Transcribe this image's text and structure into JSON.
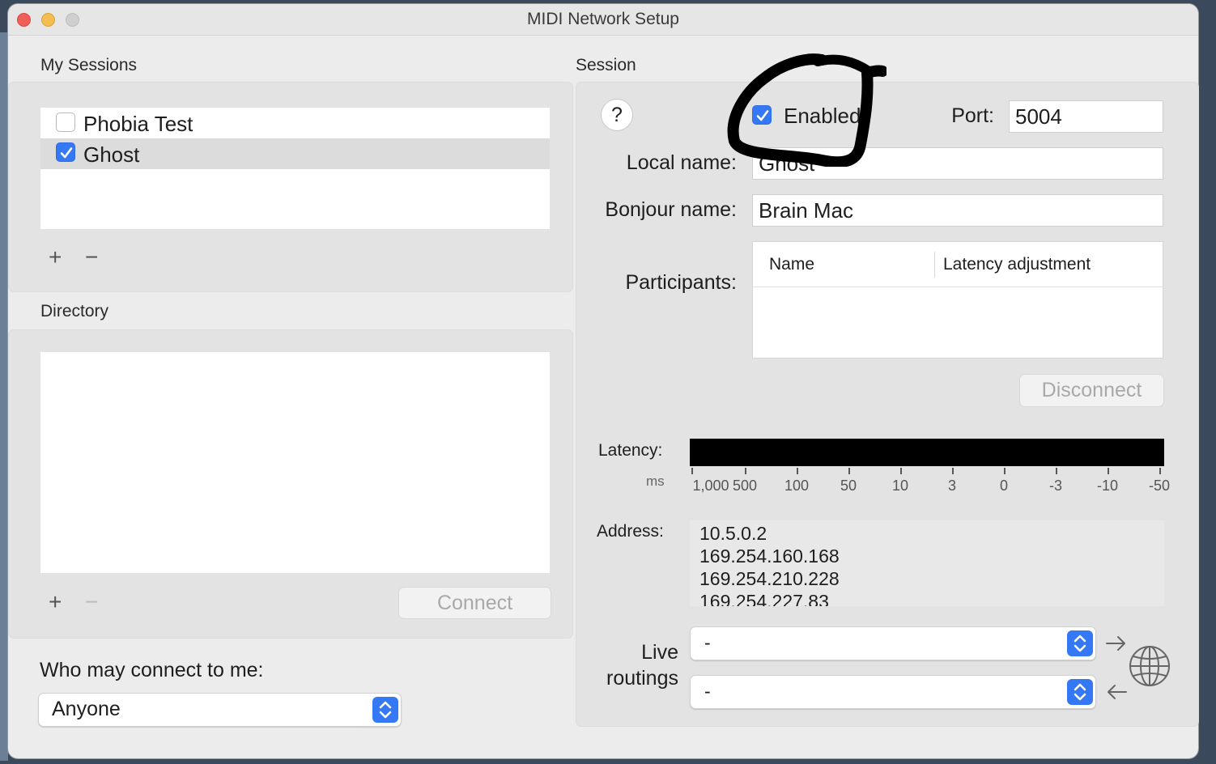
{
  "window": {
    "title": "MIDI Network Setup"
  },
  "my_sessions": {
    "label": "My Sessions",
    "items": [
      {
        "label": "Phobia Test",
        "checked": false,
        "selected": false
      },
      {
        "label": "Ghost",
        "checked": true,
        "selected": true
      }
    ],
    "add_label": "+",
    "remove_label": "−"
  },
  "directory": {
    "label": "Directory",
    "add_label": "+",
    "remove_label": "−",
    "connect_label": "Connect"
  },
  "who_may_connect": {
    "label": "Who may connect to me:",
    "selected": "Anyone"
  },
  "session": {
    "label": "Session",
    "help_label": "?",
    "enabled_label": "Enabled",
    "enabled": true,
    "port_label": "Port:",
    "port_value": "5004",
    "local_name_label": "Local name:",
    "local_name_value": "Ghost",
    "bonjour_name_label": "Bonjour name:",
    "bonjour_name_value": "Brain Mac",
    "participants_label": "Participants:",
    "participants_columns": [
      "Name",
      "Latency adjustment"
    ],
    "disconnect_label": "Disconnect",
    "latency_label": "Latency:",
    "latency_unit": "ms",
    "latency_ticks": [
      "1,000",
      "500",
      "100",
      "50",
      "10",
      "3",
      "0",
      "-3",
      "-10",
      "-50"
    ],
    "address_label": "Address:",
    "addresses": [
      "10.5.0.2",
      "169.254.160.168",
      "169.254.210.228",
      "169.254.227.83"
    ],
    "live_routings_label_1": "Live",
    "live_routings_label_2": "routings",
    "routing_in": "-",
    "routing_out": "-"
  },
  "colors": {
    "accent": "#3478f6",
    "window_bg": "#ececec",
    "annotation": "#000000"
  },
  "icons": [
    "help-icon",
    "checkbox-icon",
    "arrow-right-icon",
    "arrow-left-icon",
    "globe-icon",
    "popup-stepper-icon"
  ]
}
